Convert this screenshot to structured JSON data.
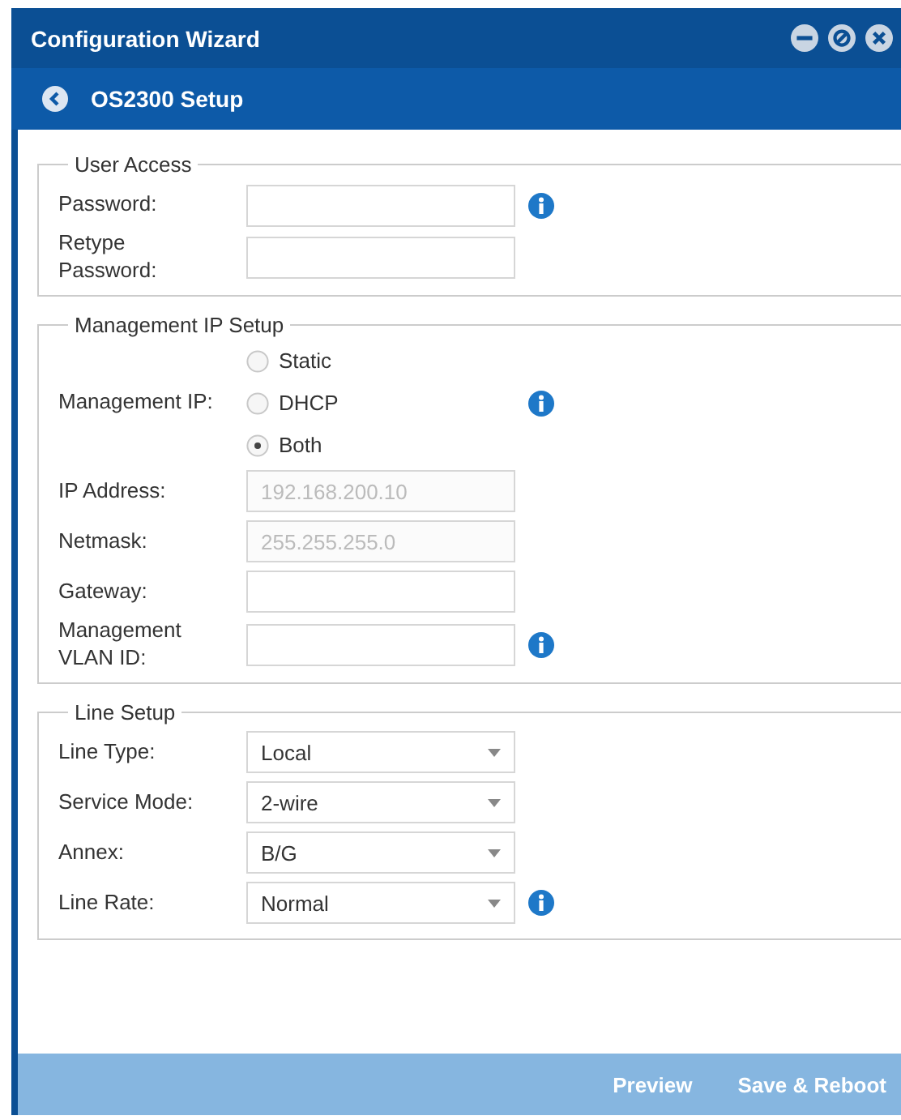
{
  "window": {
    "title": "Configuration Wizard"
  },
  "header": {
    "title": "OS2300 Setup"
  },
  "sections": [
    {
      "legend": "User Access",
      "rows": [
        {
          "kind": "text",
          "label": "Password:",
          "info": true
        },
        {
          "kind": "text",
          "label": "Retype\nPassword:"
        }
      ]
    },
    {
      "legend": "Management IP Setup",
      "rows": [
        {
          "kind": "radio",
          "label": "Management IP:",
          "info": true,
          "options": [
            {
              "label": "Static",
              "selected": false
            },
            {
              "label": "DHCP",
              "selected": false
            },
            {
              "label": "Both",
              "selected": true
            }
          ]
        },
        {
          "kind": "text",
          "label": "IP Address:",
          "value": "192.168.200.10",
          "disabled": true
        },
        {
          "kind": "text",
          "label": "Netmask:",
          "value": "255.255.255.0",
          "disabled": true
        },
        {
          "kind": "text",
          "label": "Gateway:"
        },
        {
          "kind": "text",
          "label": "Management\nVLAN ID:",
          "info": true
        }
      ]
    },
    {
      "legend": "Line Setup",
      "rows": [
        {
          "kind": "select",
          "label": "Line Type:",
          "value": "Local"
        },
        {
          "kind": "select",
          "label": "Service Mode:",
          "value": "2-wire"
        },
        {
          "kind": "select",
          "label": "Annex:",
          "value": "B/G"
        },
        {
          "kind": "select",
          "label": "Line Rate:",
          "value": "Normal",
          "info": true
        }
      ]
    }
  ],
  "footer": {
    "buttons": [
      "Preview",
      "Save & Reboot"
    ]
  }
}
